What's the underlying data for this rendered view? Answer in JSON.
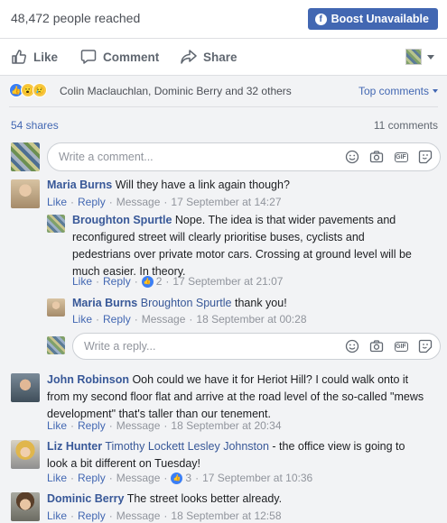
{
  "header": {
    "reach_text": "48,472 people reached",
    "boost_label": "Boost Unavailable"
  },
  "actions": {
    "like": "Like",
    "comment": "Comment",
    "share": "Share"
  },
  "reactions": {
    "icons": [
      "like-icon",
      "wow-icon",
      "sad-icon"
    ],
    "names": "Colin Maclauchlan, Dominic Berry and 32 others",
    "sort_label": "Top comments"
  },
  "counts": {
    "shares": "54 shares",
    "comments": "11 comments"
  },
  "composer": {
    "placeholder": "Write a comment...",
    "reply_placeholder": "Write a reply..."
  },
  "meta_labels": {
    "like": "Like",
    "reply": "Reply",
    "message": "Message"
  },
  "comments": [
    {
      "author": "Maria Burns",
      "text": "Will they have a link again though?",
      "time": "17 September at 14:27",
      "replies": [
        {
          "author": "Broughton Spurtle",
          "text_lines": [
            "Nope. The idea is that wider pavements and",
            "reconfigured street will clearly prioritise buses, cyclists and",
            "pedestrians over private motor cars. Crossing at ground level will be",
            "much easier. In theory."
          ],
          "reactions": "2",
          "time": "17 September at 21:07"
        },
        {
          "author": "Maria Burns",
          "tag": "Broughton Spurtle",
          "text": "thank you!",
          "time": "18 September at 00:28"
        }
      ]
    },
    {
      "author": "John Robinson",
      "text_lines": [
        "Ooh could we have it for Heriot Hill? I could walk onto it",
        "from my second floor flat and arrive at the road level of the so-called \"mews",
        "development\" that's taller than our tenement."
      ],
      "time": "18 September at 20:34"
    },
    {
      "author": "Liz Hunter",
      "tags": "Timothy Lockett Lesley Johnston",
      "text_lines": [
        " - the office view is going to",
        "look a bit different on Tuesday!"
      ],
      "reactions": "3",
      "time": "17 September at 10:36"
    },
    {
      "author": "Dominic Berry",
      "text": "The street looks better already.",
      "time": "18 September at 12:58"
    }
  ]
}
